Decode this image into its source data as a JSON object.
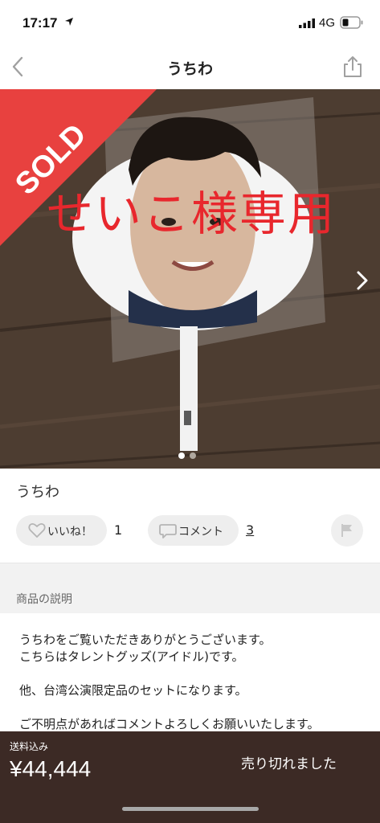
{
  "status_bar": {
    "time": "17:17",
    "network": "4G"
  },
  "nav": {
    "title": "うちわ",
    "back_icon": "chevron-left-icon",
    "share_icon": "share-icon"
  },
  "gallery": {
    "sold_badge": "SOLD",
    "overlay_text": "せいこ様専用",
    "next_icon": "chevron-right-icon",
    "image_count": 2,
    "current_index": 1
  },
  "item": {
    "name": "うちわ",
    "like_label": "いいね！",
    "like_count": "1",
    "comment_label": "コメント",
    "comment_count": "3",
    "report_icon": "flag-icon"
  },
  "description": {
    "header": "商品の説明",
    "lines": [
      "うちわをご覧いただきありがとうございます。",
      "こちらはタレントグッズ(アイドル)です。",
      "",
      "他、台湾公演限定品のセットになります。",
      "",
      "ご不明点があればコメントよろしくお願いいたします。"
    ]
  },
  "bottom": {
    "shipping_label": "送料込み",
    "price": "¥44,444",
    "status_button": "売り切れました"
  },
  "colors": {
    "sold_ribbon": "#e8413f",
    "overlay_text": "#e8272d",
    "bottom_bar": "#3c2a25",
    "pill_bg": "#eeeeee"
  }
}
